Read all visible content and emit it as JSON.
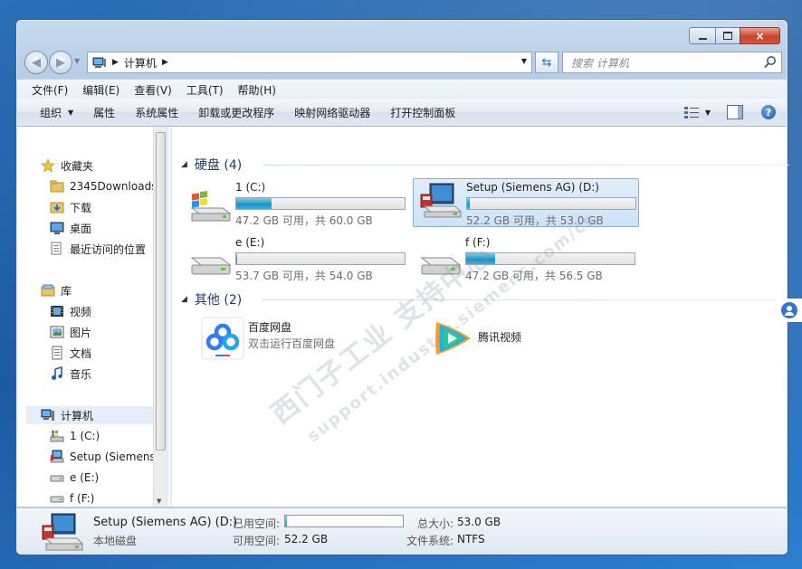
{
  "window": {
    "controls": {
      "minimize": "minimize",
      "maximize": "maximize",
      "close": "×"
    }
  },
  "address": {
    "path": "计算机",
    "search_placeholder": "搜索 计算机"
  },
  "menu": [
    "文件(F)",
    "编辑(E)",
    "查看(V)",
    "工具(T)",
    "帮助(H)"
  ],
  "commands": [
    "组织",
    "属性",
    "系统属性",
    "卸载或更改程序",
    "映射网络驱动器",
    "打开控制面板"
  ],
  "nav": {
    "favorites": {
      "label": "收藏夹",
      "items": [
        "2345Downloads",
        "下载",
        "桌面",
        "最近访问的位置"
      ]
    },
    "libraries": {
      "label": "库",
      "items": [
        "视频",
        "图片",
        "文档",
        "音乐"
      ]
    },
    "computer": {
      "label": "计算机",
      "items": [
        "1 (C:)",
        "Setup (Siemens",
        "e (E:)",
        "f (F:)"
      ]
    }
  },
  "groups": {
    "hdd": {
      "label": "硬盘 (4)"
    },
    "other": {
      "label": "其他 (2)"
    }
  },
  "drives": [
    {
      "name": "1 (C:)",
      "free": "47.2 GB 可用，共 60.0 GB",
      "used_fraction": 0.21,
      "icon": "windows-drive-icon"
    },
    {
      "name": "Setup (Siemens AG) (D:)",
      "free": "52.2 GB 可用，共 53.0 GB",
      "used_fraction": 0.015,
      "icon": "setup-drive-icon"
    },
    {
      "name": "e (E:)",
      "free": "53.7 GB 可用，共 54.0 GB",
      "used_fraction": 0.006,
      "icon": "hard-drive-icon"
    },
    {
      "name": "f (F:)",
      "free": "47.2 GB 可用，共 56.5 GB",
      "used_fraction": 0.17,
      "icon": "hard-drive-icon"
    }
  ],
  "apps": [
    {
      "name": "百度网盘",
      "desc": "双击运行百度网盘",
      "icon": "baidu-netdisk-icon"
    },
    {
      "name": "腾讯视频",
      "desc": "",
      "icon": "tencent-video-icon"
    }
  ],
  "details": {
    "name": "Setup (Siemens AG) (D:)",
    "type": "本地磁盘",
    "used_label": "已用空间:",
    "used_fraction": 0.015,
    "free_label": "可用空间:",
    "free_value": "52.2 GB",
    "total_label": "总大小:",
    "total_value": "53.0 GB",
    "fs_label": "文件系统:",
    "fs_value": "NTFS"
  },
  "colors": {
    "accent": "#2a9fd0",
    "group_header": "#1e3a6e",
    "selection": "#cde2f8"
  }
}
